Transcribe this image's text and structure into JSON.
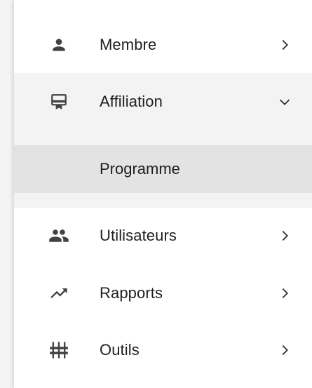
{
  "menu": {
    "items": [
      {
        "label": "Membre",
        "icon": "person-icon",
        "chevron": "chevron-right"
      },
      {
        "label": "Affiliation",
        "icon": "card-membership-icon",
        "chevron": "chevron-down",
        "expanded": true,
        "children": [
          {
            "label": "Programme",
            "selected": true
          }
        ]
      },
      {
        "label": "Utilisateurs",
        "icon": "people-icon",
        "chevron": "chevron-right"
      },
      {
        "label": "Rapports",
        "icon": "trending-up-icon",
        "chevron": "chevron-right"
      },
      {
        "label": "Outils",
        "icon": "equalizer-tools-icon",
        "chevron": "chevron-right"
      }
    ]
  },
  "colors": {
    "icon": "#424242",
    "text": "#1f1f1f",
    "expanded_bg": "#f3f3f3",
    "selected_bg": "#e3e3e3"
  }
}
